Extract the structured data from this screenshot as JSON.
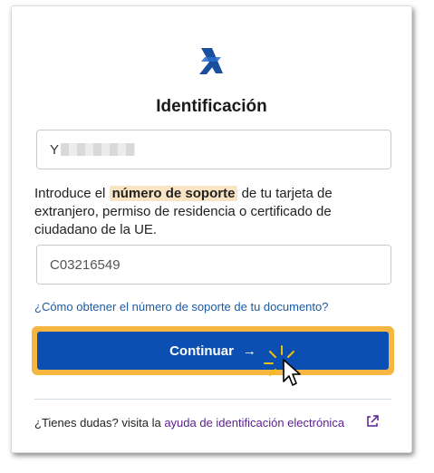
{
  "form": {
    "title": "Identificación",
    "nie_value_prefix": "Y",
    "description_before": "Introduce el ",
    "description_highlight": "número de soporte",
    "description_after": " de tu tarjeta de extranjero, permiso de residencia o certificado de ciudadano de la UE.",
    "support_number_value": "C03216549",
    "help_link": "¿Cómo obtener el número de soporte de tu documento?",
    "continue_label": "Continuar",
    "continue_arrow": "→",
    "footer_text": "¿Tienes dudas? visita la ",
    "footer_link": "ayuda de identificación electrónica"
  },
  "icons": {
    "logo": "agencia-tributaria-logo",
    "external": "external-link-icon",
    "cursor": "mouse-pointer-icon"
  },
  "colors": {
    "primary": "#0b4fb3",
    "focus_ring": "#f5b642",
    "link": "#1a5ba8",
    "visited_link": "#5b1f8f",
    "highlight_bg": "#fbe4c4"
  }
}
